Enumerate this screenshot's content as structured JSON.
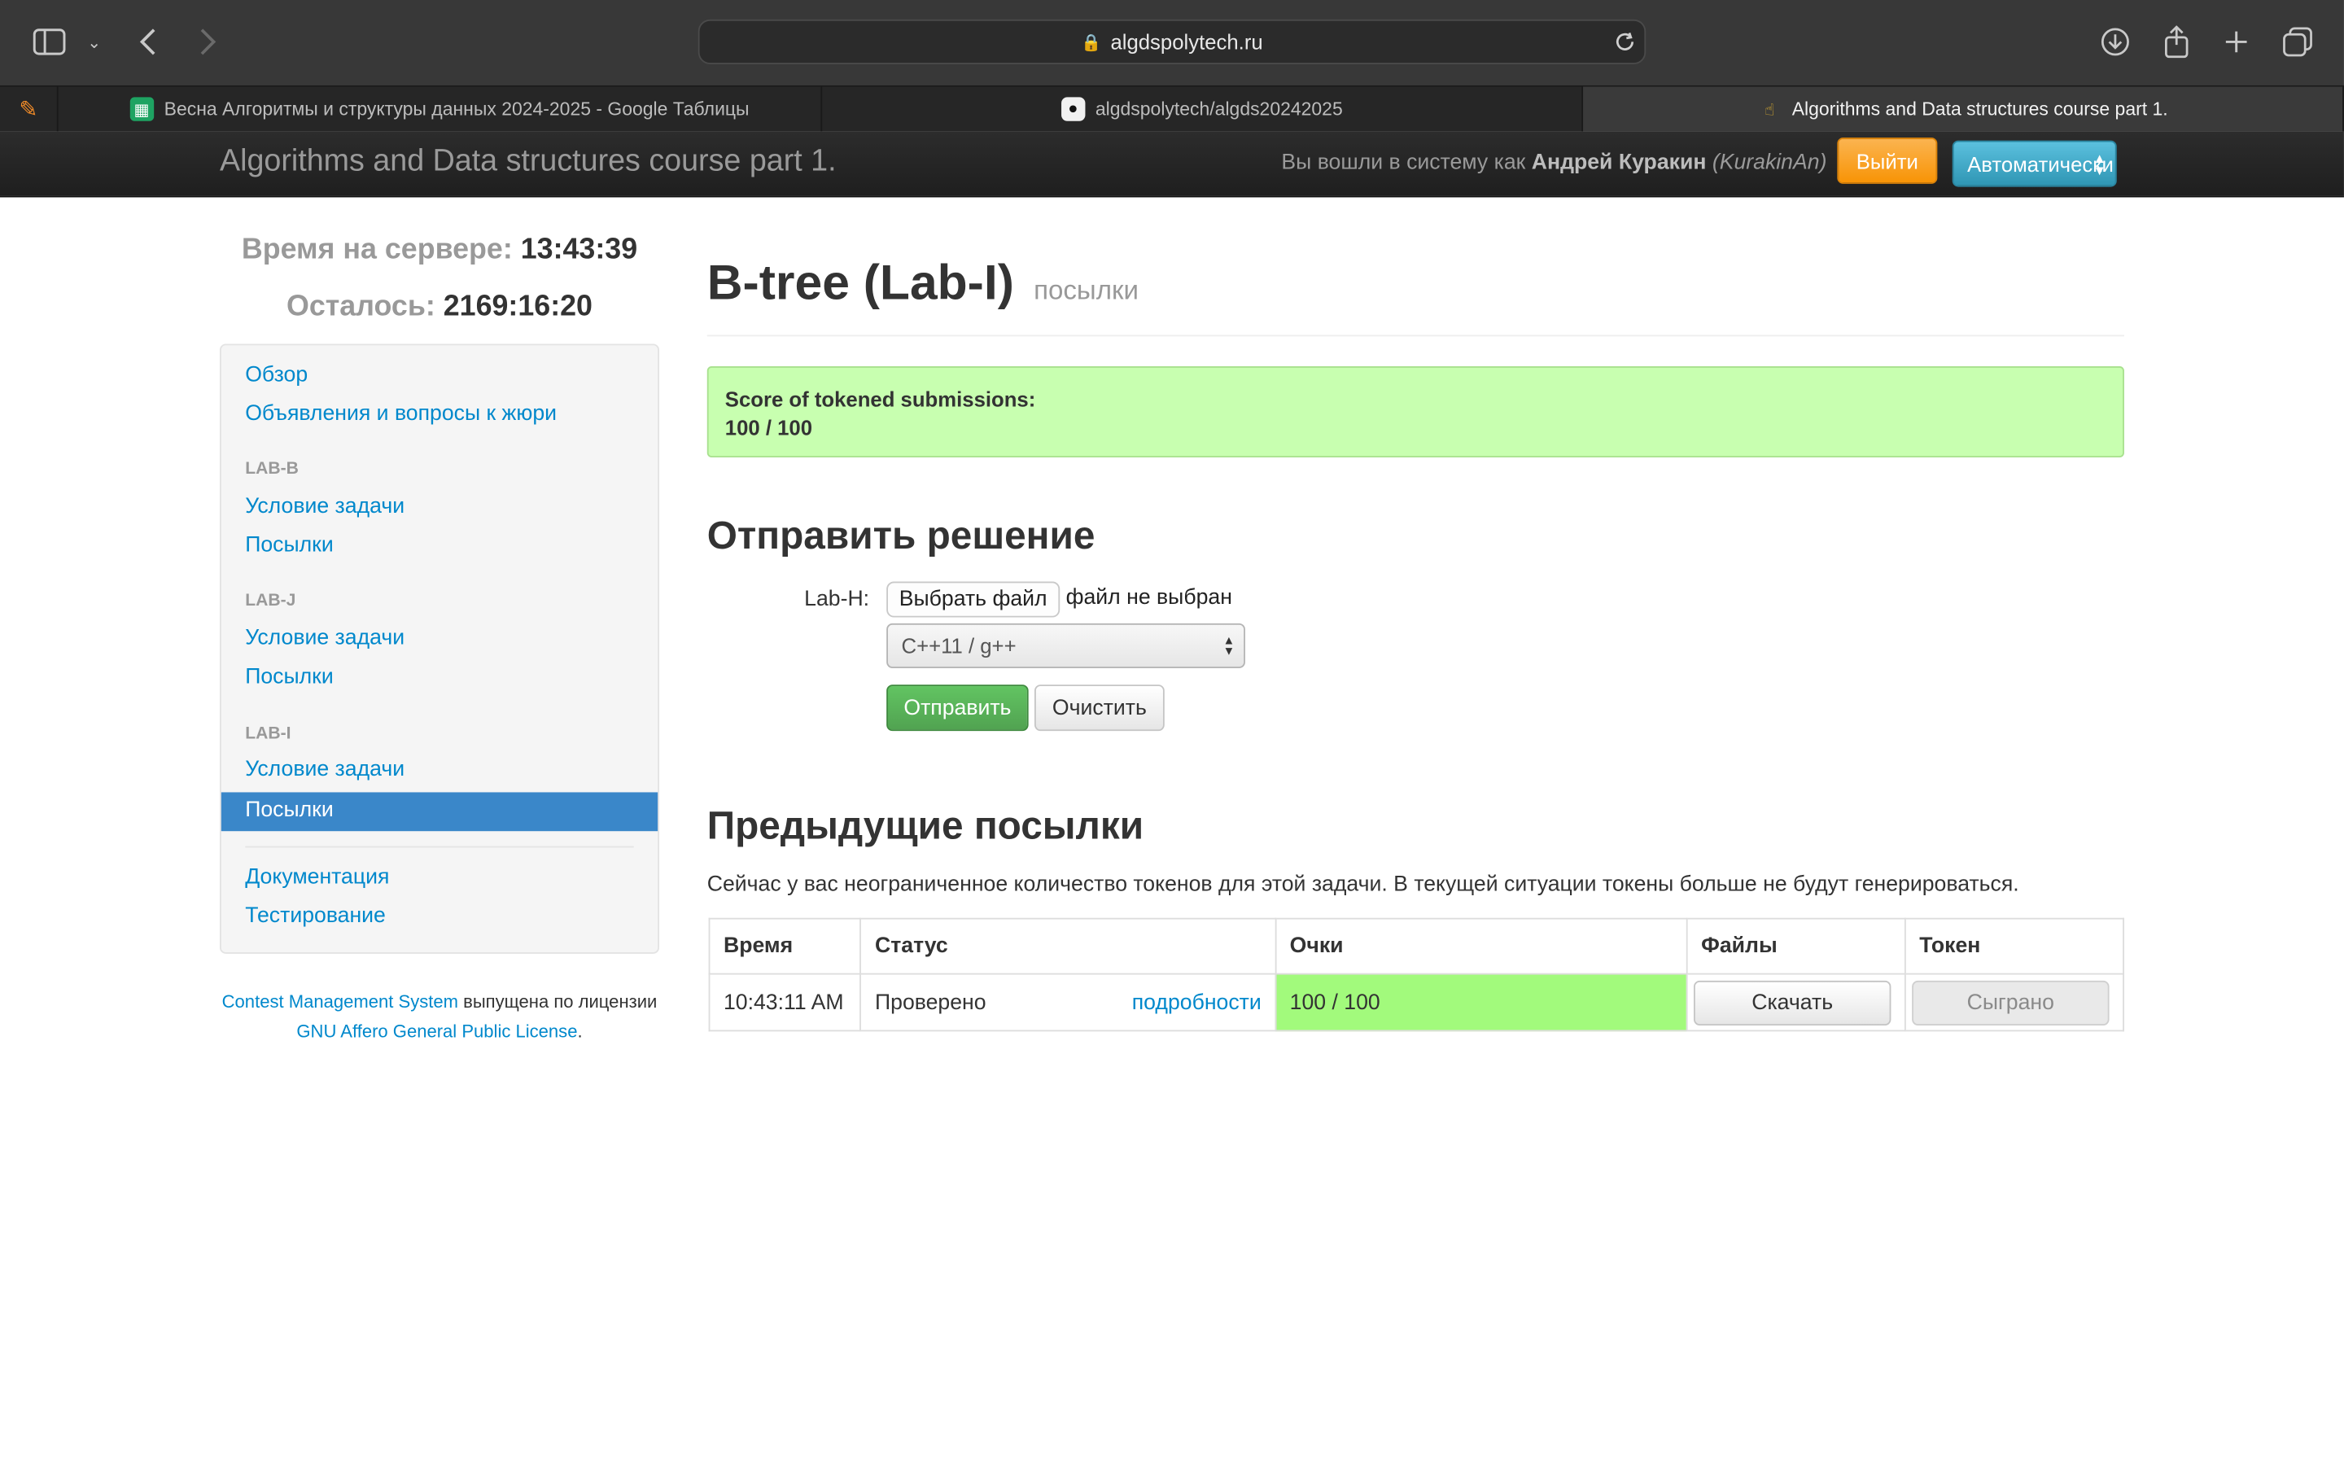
{
  "browser": {
    "address": "algdspolytech.ru",
    "tabs": [
      {
        "title": "Весна Алгоритмы и структуры данных 2024-2025 - Google Таблицы",
        "icon": "google-sheets-icon",
        "active": false
      },
      {
        "title": "algdspolytech/algds20242025",
        "icon": "github-icon",
        "active": false
      },
      {
        "title": "Algorithms and Data structures course part 1.",
        "icon": "cms-icon",
        "active": true
      }
    ]
  },
  "navbar": {
    "brand": "Algorithms and Data structures course part 1.",
    "login_prefix": "Вы вошли в систему как",
    "user_name": "Андрей Куракин",
    "user_login": "(KurakinAn)",
    "logout_label": "Выйти",
    "language_selected": "Автоматически"
  },
  "sidebar": {
    "server_time_label": "Время на сервере:",
    "server_time_value": "13:43:39",
    "time_left_label": "Осталось:",
    "time_left_value": "2169:16:20",
    "overview": "Обзор",
    "announcements": "Объявления и вопросы к жюри",
    "sections": [
      {
        "name": "LAB-B",
        "statement": "Условие задачи",
        "submissions": "Посылки"
      },
      {
        "name": "LAB-J",
        "statement": "Условие задачи",
        "submissions": "Посылки"
      },
      {
        "name": "LAB-I",
        "statement": "Условие задачи",
        "submissions": "Посылки"
      }
    ],
    "documentation": "Документация",
    "testing": "Тестирование",
    "footer_cms": "Contest Management System",
    "footer_mid": "выпущена по лицензии",
    "footer_license": "GNU Affero General Public License",
    "footer_end": "."
  },
  "main": {
    "title": "B-tree (Lab-I)",
    "subtitle": "посылки",
    "score_label": "Score of tokened submissions:",
    "score_value": "100 / 100",
    "submit_heading": "Отправить решение",
    "file_label": "Lab-H:",
    "choose_file": "Выбрать файл",
    "no_file": "файл не выбран",
    "language": "C++11 / g++",
    "submit_button": "Отправить",
    "clear_button": "Очистить",
    "previous_heading": "Предыдущие посылки",
    "token_note": "Сейчас у вас неограниченное количество токенов для этой задачи. В текущей ситуации токены больше не будут генерироваться.",
    "table": {
      "headers": [
        "Время",
        "Статус",
        "Очки",
        "Файлы",
        "Токен"
      ],
      "rows": [
        {
          "time": "10:43:11 AM",
          "status": "Проверено",
          "details": "подробности",
          "score": "100 / 100",
          "files": "Скачать",
          "token": "Сыграно"
        }
      ]
    }
  },
  "colors": {
    "score_ok": "#a2fa7c",
    "score_box": "#c8ffb0",
    "active_nav": "#3a87c9",
    "logout": "#f89406",
    "submit": "#51a351"
  }
}
